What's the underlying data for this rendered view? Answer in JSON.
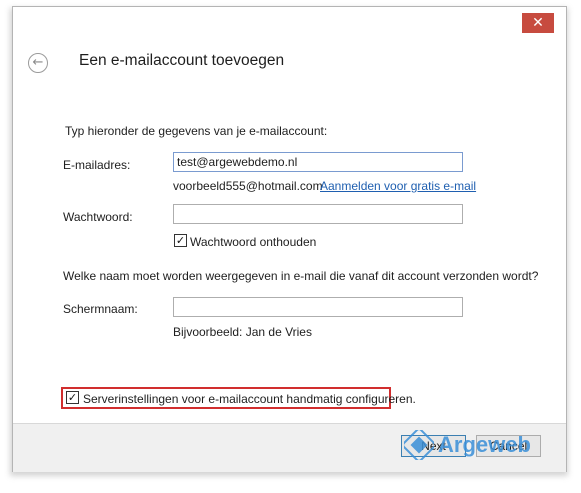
{
  "window": {
    "title": "Een e-mailaccount toevoegen",
    "close_glyph": "✕",
    "back_glyph": "←"
  },
  "form": {
    "intro": "Typ hieronder de gegevens van je e-mailaccount:",
    "email_label": "E-mailadres:",
    "email_value": "test@argewebdemo.nl",
    "email_example": "voorbeeld555@hotmail.com",
    "signup_link": "Aanmelden voor gratis e-mail",
    "password_label": "Wachtwoord:",
    "password_value": "",
    "remember_label": "Wachtwoord onthouden",
    "remember_checked": true,
    "display_question": "Welke naam moet worden weergegeven in e-mail die vanaf dit account verzonden wordt?",
    "display_label": "Schermnaam:",
    "display_value": "",
    "display_example": "Bijvoorbeeld: Jan de Vries",
    "manual_config_label": "Serverinstellingen voor e-mailaccount handmatig configureren.",
    "manual_config_checked": true
  },
  "footer": {
    "next_label": "Next",
    "cancel_label": "Cancel"
  },
  "watermark": {
    "text": "Argeweb",
    "color": "#3a8fd8"
  },
  "colors": {
    "close_button": "#c74b3f",
    "highlight": "#d12e2e",
    "link": "#1f5fb0"
  }
}
